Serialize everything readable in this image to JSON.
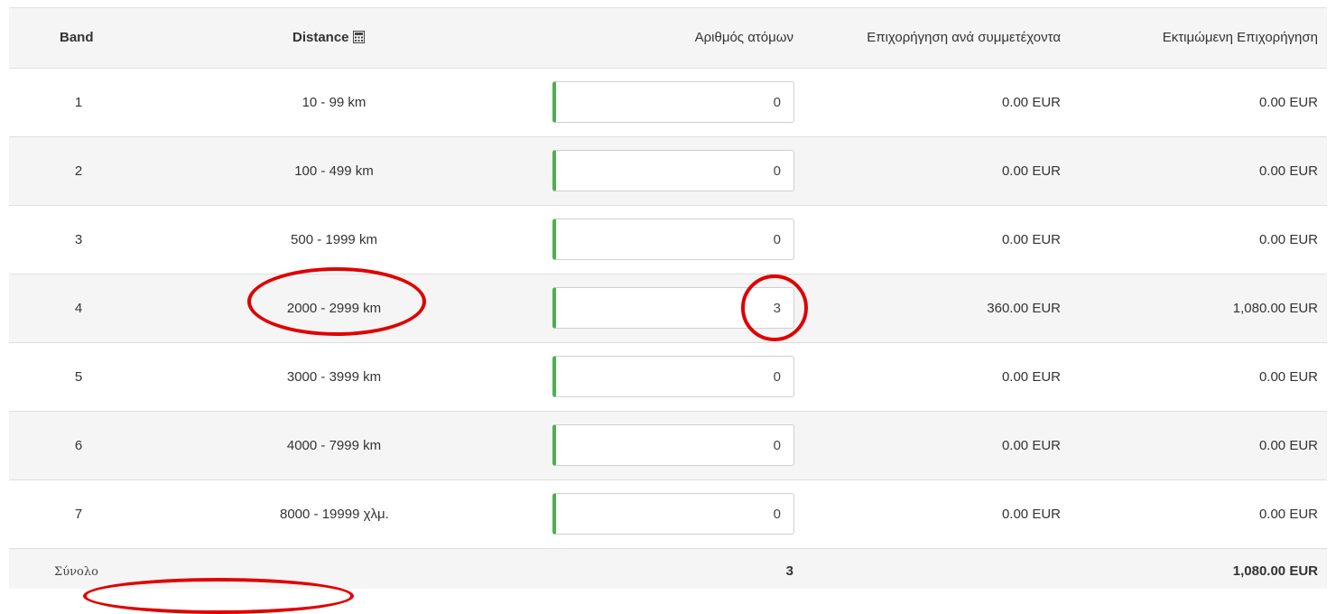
{
  "table": {
    "headers": {
      "band": "Band",
      "distance": "Distance",
      "persons": "Αριθμός ατόμων",
      "grant_per_participant": "Επιχορήγηση ανά συμμετέχοντα",
      "estimated_grant": "Εκτιμώμενη Επιχορήγηση"
    },
    "distance_header_icon": "calculator-icon",
    "rows": [
      {
        "band": "1",
        "distance": "10 - 99 km",
        "persons": "0",
        "grant_per": "0.00 EUR",
        "estimated": "0.00 EUR"
      },
      {
        "band": "2",
        "distance": "100 - 499 km",
        "persons": "0",
        "grant_per": "0.00 EUR",
        "estimated": "0.00 EUR"
      },
      {
        "band": "3",
        "distance": "500 - 1999 km",
        "persons": "0",
        "grant_per": "0.00 EUR",
        "estimated": "0.00 EUR"
      },
      {
        "band": "4",
        "distance": "2000 - 2999 km",
        "persons": "3",
        "grant_per": "360.00 EUR",
        "estimated": "1,080.00 EUR"
      },
      {
        "band": "5",
        "distance": "3000 - 3999 km",
        "persons": "0",
        "grant_per": "0.00 EUR",
        "estimated": "0.00 EUR"
      },
      {
        "band": "6",
        "distance": "4000 - 7999 km",
        "persons": "0",
        "grant_per": "0.00 EUR",
        "estimated": "0.00 EUR"
      },
      {
        "band": "7",
        "distance": "8000 - 19999 χλμ.",
        "persons": "0",
        "grant_per": "0.00 EUR",
        "estimated": "0.00 EUR"
      }
    ],
    "footer": {
      "label": "Σύνολο",
      "total_persons": "3",
      "total_grant": "1,080.00 EUR"
    }
  },
  "colors": {
    "input_accent": "#4caf50",
    "annotation": "#e00000",
    "header_bg": "#f5f5f5"
  }
}
